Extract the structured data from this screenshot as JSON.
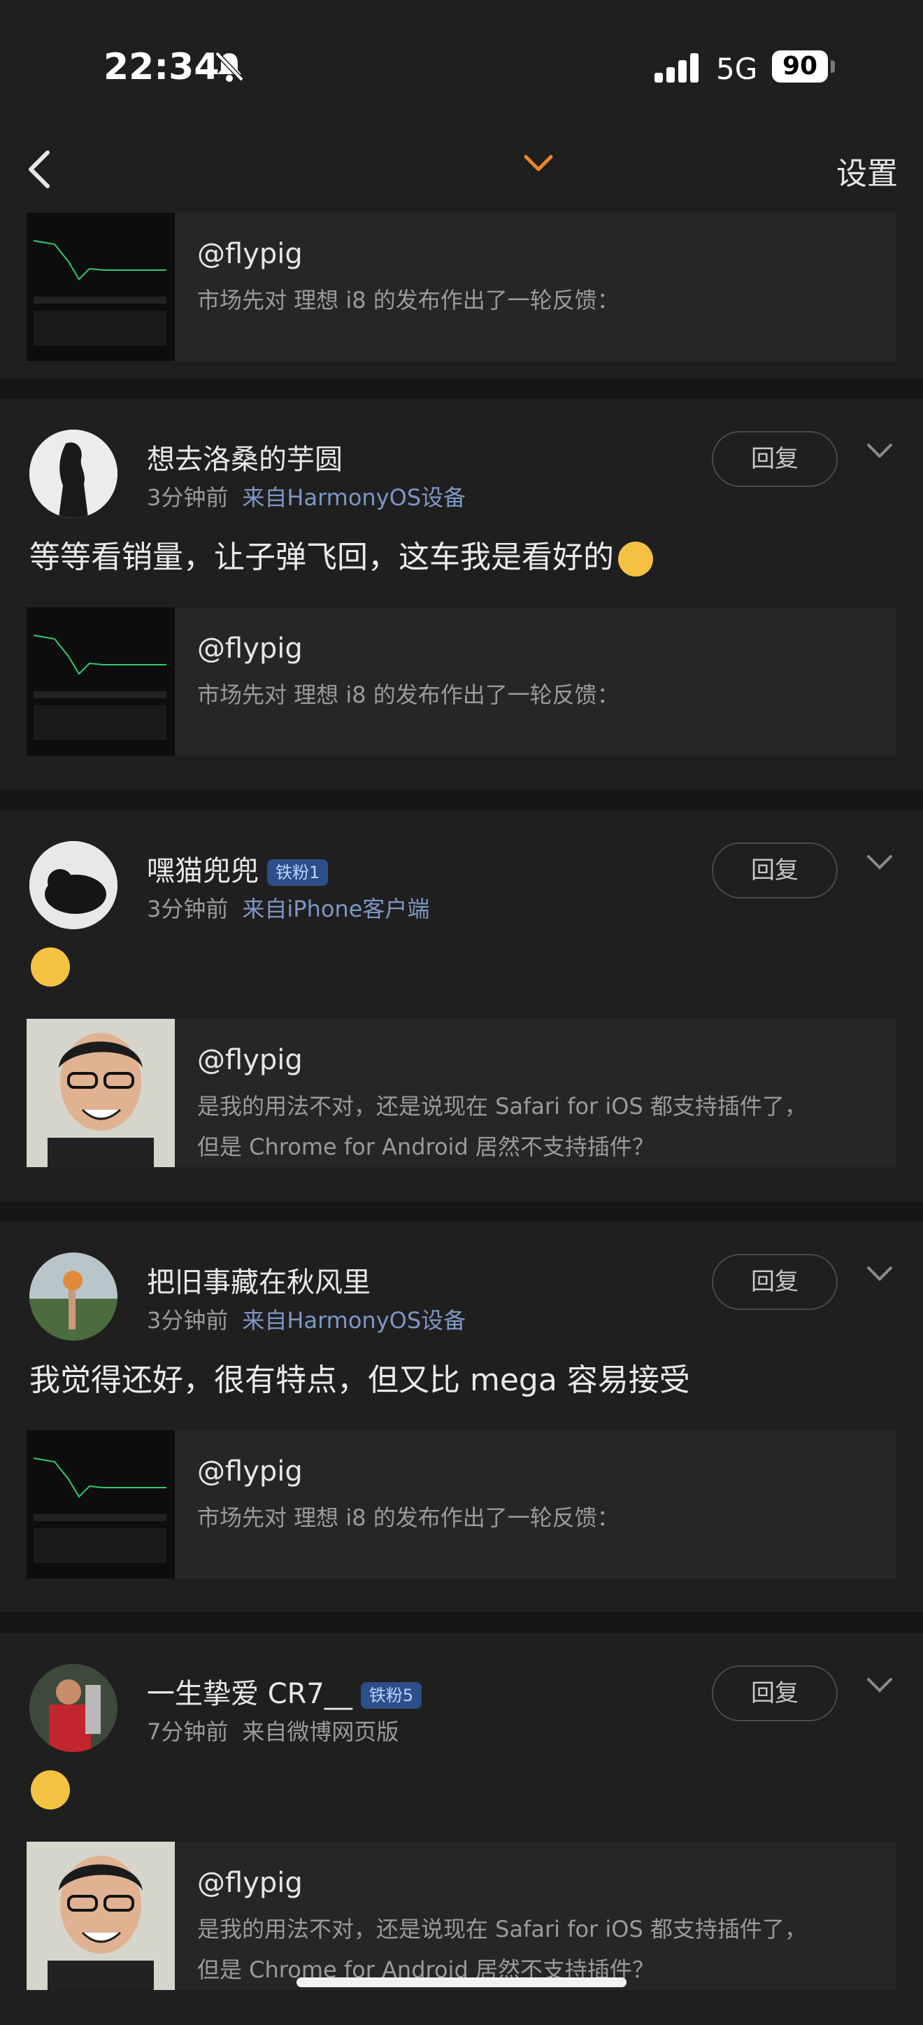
{
  "status": {
    "time": "22:34",
    "network": "5G",
    "battery": "90"
  },
  "nav": {
    "settings": "设置"
  },
  "top_quote": {
    "user": "@flypig",
    "text": "市场先对 理想 i8 的发布作出了一轮反馈："
  },
  "comments": [
    {
      "name": "想去洛桑的芋圆",
      "time": "3分钟前",
      "from_label": "来自",
      "source": "HarmonyOS设备",
      "reply": "回复",
      "content": "等等看销量，让子弹飞回，这车我是看好的",
      "quote": {
        "user": "@flypig",
        "line1": "市场先对 理想 i8 的发布作出了一轮反馈："
      }
    },
    {
      "name": "嘿猫兜兜",
      "badge": "铁粉1",
      "time": "3分钟前",
      "from_label": "来自",
      "source": "iPhone客户端",
      "reply": "回复",
      "quote": {
        "user": "@flypig",
        "line1": "是我的用法不对，还是说现在 Safari for iOS 都支持插件了，",
        "line2": "但是 Chrome for Android 居然不支持插件？"
      }
    },
    {
      "name": "把旧事藏在秋风里",
      "time": "3分钟前",
      "from_label": "来自",
      "source": "HarmonyOS设备",
      "reply": "回复",
      "content": "我觉得还好，很有特点，但又比 mega 容易接受",
      "quote": {
        "user": "@flypig",
        "line1": "市场先对 理想 i8 的发布作出了一轮反馈："
      }
    },
    {
      "name": "一生挚爱 CR7__",
      "badge": "铁粉5",
      "time": "7分钟前",
      "from_label": "来自",
      "source": "微博网页版",
      "reply": "回复",
      "quote": {
        "user": "@flypig",
        "line1": "是我的用法不对，还是说现在 Safari for iOS 都支持插件了，",
        "line2": "但是 Chrome for Android 居然不支持插件？"
      }
    }
  ]
}
